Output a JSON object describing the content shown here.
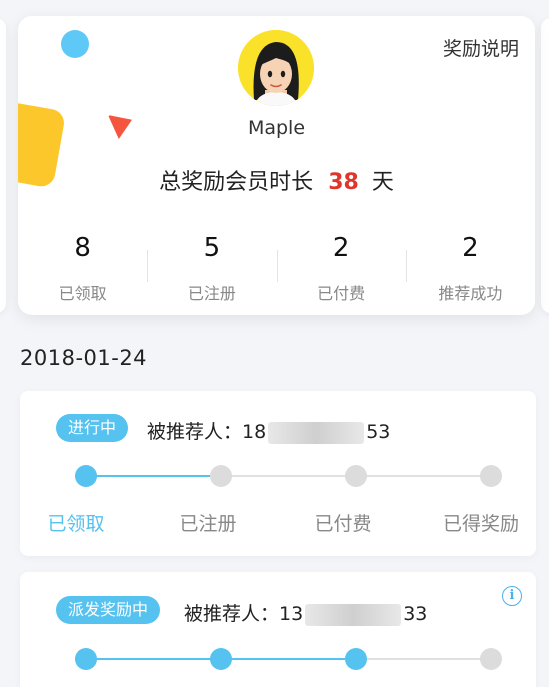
{
  "header": {
    "reward_link": "奖励说明",
    "username": "Maple",
    "total_label": "总奖励会员时长",
    "total_days": "38",
    "total_unit": "天"
  },
  "stats": [
    {
      "value": "8",
      "label": "已领取"
    },
    {
      "value": "5",
      "label": "已注册"
    },
    {
      "value": "2",
      "label": "已付费"
    },
    {
      "value": "2",
      "label": "推荐成功"
    }
  ],
  "date": "2018-01-24",
  "records": [
    {
      "status": "进行中",
      "referee_label": "被推荐人：",
      "phone_prefix": "18",
      "phone_suffix": "53",
      "completed_steps": 1,
      "steps": [
        "已领取",
        "已注册",
        "已付费",
        "已得奖励"
      ]
    },
    {
      "status": "派发奖励中",
      "referee_label": "被推荐人：",
      "phone_prefix": "13",
      "phone_suffix": "33",
      "completed_steps": 3,
      "info_icon": "info-icon"
    }
  ],
  "colors": {
    "accent": "#55c2f0",
    "highlight": "#e0352b",
    "avatar_bg": "#fbe22a"
  }
}
